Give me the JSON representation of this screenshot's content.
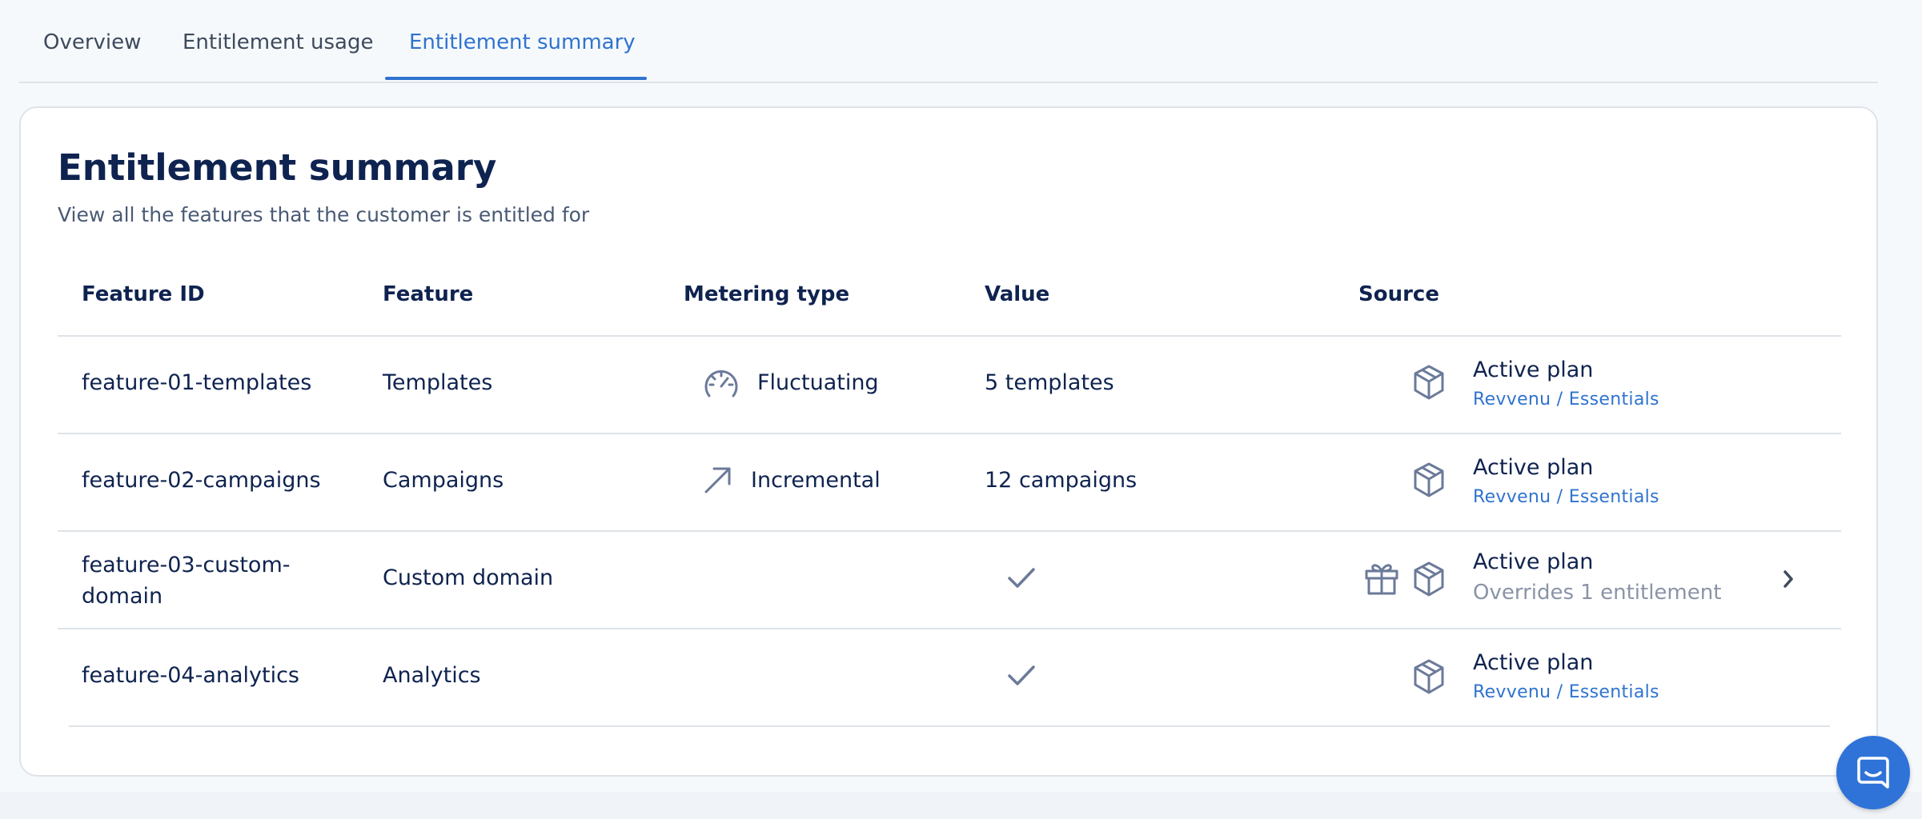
{
  "tabs": [
    {
      "label": "Overview",
      "active": false
    },
    {
      "label": "Entitlement usage",
      "active": false
    },
    {
      "label": "Entitlement summary",
      "active": true
    }
  ],
  "card": {
    "title": "Entitlement summary",
    "subtitle": "View all the features that the customer is entitled for"
  },
  "table": {
    "headers": [
      "Feature ID",
      "Feature",
      "Metering type",
      "Value",
      "Source"
    ],
    "rows": [
      {
        "feature_id": "feature-01-templates",
        "feature": "Templates",
        "metering_icon": "gauge-icon",
        "metering_type": "Fluctuating",
        "value": "5 templates",
        "source_title": "Active plan",
        "source_detail": "Revvenu / Essentials"
      },
      {
        "feature_id": "feature-02-campaigns",
        "feature": "Campaigns",
        "metering_icon": "arrow-up-right-icon",
        "metering_type": "Incremental",
        "value": "12 campaigns",
        "source_title": "Active plan",
        "source_detail": "Revvenu / Essentials"
      },
      {
        "feature_id": "feature-03-custom-domain",
        "feature": "Custom domain",
        "metering_type": "",
        "value_icon": "check-icon",
        "source_title": "Active plan",
        "source_detail": "Overrides 1 entitlement"
      },
      {
        "feature_id": "feature-04-analytics",
        "feature": "Analytics",
        "metering_type": "",
        "value_icon": "check-icon",
        "source_title": "Active plan",
        "source_detail": "Revvenu / Essentials"
      }
    ]
  },
  "colors": {
    "accent": "#2f73cf",
    "text": "#0f2350",
    "icon": "#6b7a99",
    "border": "#dfe3e8"
  }
}
